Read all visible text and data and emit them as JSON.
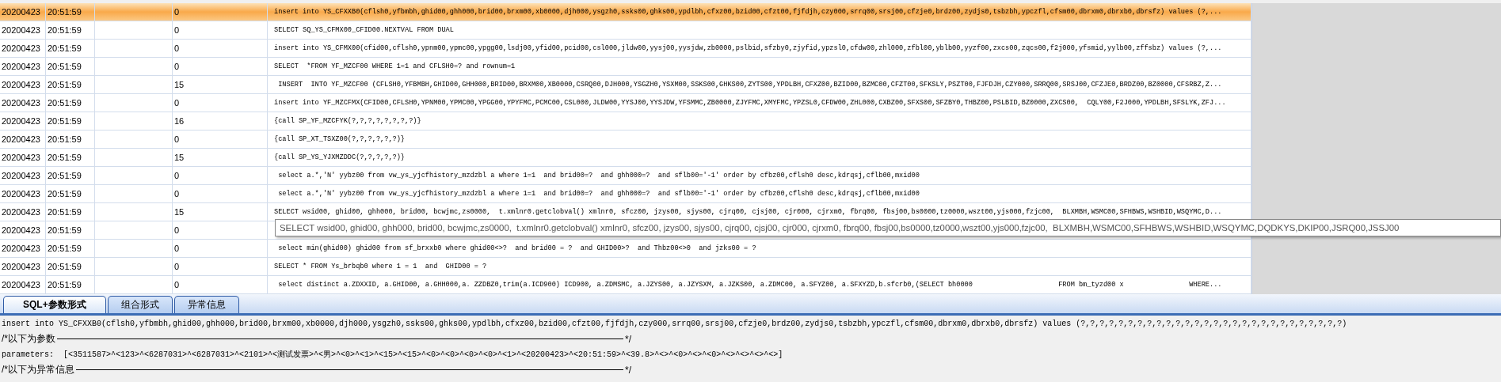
{
  "log_table": {
    "rows": [
      {
        "date": "20200423",
        "time": "20:51:59",
        "count": "0",
        "sql": "insert into YS_CFXXB0(cflsh0,yfbmbh,ghid00,ghh000,brid00,brxm00,xb0000,djh000,ysgzh0,ssks00,ghks00,ypdlbh,cfxz00,bzid00,cfzt00,fjfdjh,czy000,srrq00,srsj00,cfzje0,brdz00,zydjs0,tsbzbh,ypczfl,cfsm00,dbrxm0,dbrxb0,dbrsfz) values (?,...",
        "selected": true
      },
      {
        "date": "20200423",
        "time": "20:51:59",
        "count": "0",
        "sql": "SELECT SQ_YS_CFMX00_CFID00.NEXTVAL FROM DUAL",
        "selected": false
      },
      {
        "date": "20200423",
        "time": "20:51:59",
        "count": "0",
        "sql": "insert into YS_CFMX00(cfid00,cflsh0,ypnm00,ypmc00,ypgg00,lsdj00,yfid00,pcid00,csl000,jldw00,yysj00,yysjdw,zb0000,pslbid,sfzby0,zjyfid,ypzsl0,cfdw00,zhl000,zfbl00,yblb00,yyzf00,zxcs00,zqcs00,f2j000,yfsmid,yylb00,zffsbz) values (?,...",
        "selected": false
      },
      {
        "date": "20200423",
        "time": "20:51:59",
        "count": "0",
        "sql": "SELECT  *FROM YF_MZCF00 WHERE 1=1 and CFLSH0=? and rownum=1",
        "selected": false
      },
      {
        "date": "20200423",
        "time": "20:51:59",
        "count": "15",
        "sql": " INSERT  INTO YF_MZCF00 (CFLSH0,YFBMBH,GHID00,GHH000,BRID00,BRXM00,XB0000,CSRQ00,DJH000,YSGZH0,YSXM00,SSKS00,GHKS00,ZYTS00,YPDLBH,CFXZ00,BZID00,BZMC00,CFZT00,SFKSLY,PSZT00,FJFDJH,CZY000,SRRQ00,SRSJ00,CFZJE0,BRDZ00,BZ0000,CFSRBZ,Z...",
        "selected": false
      },
      {
        "date": "20200423",
        "time": "20:51:59",
        "count": "0",
        "sql": "insert into YF_MZCFMX(CFID00,CFLSH0,YPNM00,YPMC00,YPGG00,YPYFMC,PCMC00,CSL000,JLDW00,YYSJ00,YYSJDW,YFSMMC,ZB0000,ZJYFMC,XMYFMC,YPZSL0,CFDW00,ZHL000,CXBZ00,SFXS00,SFZBY0,THBZ00,PSLBID,BZ0000,ZXCS00,  CQLY00,F2J000,YPDLBH,SFSLYK,ZFJ...",
        "selected": false
      },
      {
        "date": "20200423",
        "time": "20:51:59",
        "count": "16",
        "sql": "{call SP_YF_MZCFYK(?,?,?,?,?,?,?,?)}",
        "selected": false
      },
      {
        "date": "20200423",
        "time": "20:51:59",
        "count": "0",
        "sql": "{call SP_XT_TSXZ00(?,?,?,?,?,?)}",
        "selected": false
      },
      {
        "date": "20200423",
        "time": "20:51:59",
        "count": "15",
        "sql": "{call SP_YS_YJXMZDDC(?,?,?,?,?)}",
        "selected": false
      },
      {
        "date": "20200423",
        "time": "20:51:59",
        "count": "0",
        "sql": " select a.*,'N' yybz00 from vw_ys_yjcfhistory_mzdzbl a where 1=1  and brid00=?  and ghh000=?  and sflb00='-1' order by cfbz00,cflsh0 desc,kdrqsj,cflb00,mxid00",
        "selected": false
      },
      {
        "date": "20200423",
        "time": "20:51:59",
        "count": "0",
        "sql": " select a.*,'N' yybz00 from vw_ys_yjcfhistory_mzdzbl a where 1=1  and brid00=?  and ghh000=?  and sflb00='-1' order by cfbz00,cflsh0 desc,kdrqsj,cflb00,mxid00",
        "selected": false
      },
      {
        "date": "20200423",
        "time": "20:51:59",
        "count": "15",
        "sql": "SELECT wsid00, ghid00, ghh000, brid00, bcwjmc,zs0000,  t.xmlnr0.getclobval() xmlnr0, sfcz00, jzys00, sjys00, cjrq00, cjsj00, cjr000, cjrxm0, fbrq00, fbsj00,bs0000,tz0000,wszt00,yjs000,fzjc00,  BLXMBH,WSMC00,SFHBWS,WSHBID,WSQYMC,D...",
        "selected": false
      },
      {
        "date": "20200423",
        "time": "20:51:59",
        "count": "0",
        "selected": false
      },
      {
        "date": "20200423",
        "time": "20:51:59",
        "count": "0",
        "sql": " select min(ghid00) ghid00 from sf_brxxb0 where ghid00<>?  and brid00 = ?  and GHID00>?  and Thbz00<>0  and jzks00 = ?",
        "selected": false
      },
      {
        "date": "20200423",
        "time": "20:51:59",
        "count": "0",
        "sql": "SELECT * FROM Ys_brbqb0 where 1 = 1  and  GHID00 = ?",
        "selected": false
      },
      {
        "date": "20200423",
        "time": "20:51:59",
        "count": "0",
        "sql": " select distinct a.ZDXXID, a.GHID00, a.GHH000,a. ZZDBZ0,trim(a.ICD900) ICD900, a.ZDMSMC, a.JZYS00, a.JZYSXM, a.JZKS00, a.ZDMC00, a.SFYZ00, a.SFXYZD,b.sfcrb0,(SELECT bh0000                     FROM bm_tyzd00 x                WHERE...",
        "selected": false
      }
    ]
  },
  "tooltip": {
    "text": "SELECT wsid00, ghid00, ghh000, brid00, bcwjmc,zs0000,  t.xmlnr0.getclobval() xmlnr0, sfcz00, jzys00, sjys00, cjrq00, cjsj00, cjr000, cjrxm0, fbrq00, fbsj00,bs0000,tz0000,wszt00,yjs000,fzjc00,  BLXMBH,WSMC00,SFHBWS,WSHBID,WSQYMC,DQDKYS,DKIP00,JSRQ00,JSSJ00"
  },
  "tabs": [
    {
      "label": "SQL+参数形式",
      "selected": true
    },
    {
      "label": "组合形式",
      "selected": false
    },
    {
      "label": "异常信息",
      "selected": false
    }
  ],
  "detail": {
    "lines": [
      {
        "kind": "text",
        "text": "insert into YS_CFXXB0(cflsh0,yfbmbh,ghid00,ghh000,brid00,brxm00,xb0000,djh000,ysgzh0,ssks00,ghks00,ypdlbh,cfxz00,bzid00,cfzt00,fjfdjh,czy000,srrq00,srsj00,cfzje0,brdz00,zydjs0,tsbzbh,ypczfl,cfsm00,dbrxm0,dbrxb0,dbrsfz) values (?,?,?,?,?,?,?,?,?,?,?,?,?,?,?,?,?,?,?,?,?,?,?,?,?,?,?,?)"
      },
      {
        "kind": "divider",
        "text": "/*以下为参数",
        "end": "*/"
      },
      {
        "kind": "text",
        "text": "parameters:  [<3511587>^<123>^<6287031>^<6287031>^<2101>^<测试发票>^<男>^<0>^<1>^<15>^<15>^<0>^<0>^<0>^<0>^<1>^<20200423>^<20:51:59>^<39.8>^<>^<0>^<>^<0>^<>^<>^<>^<>]"
      },
      {
        "kind": "divider",
        "text": "/*以下为异常信息",
        "end": "*/"
      }
    ]
  }
}
